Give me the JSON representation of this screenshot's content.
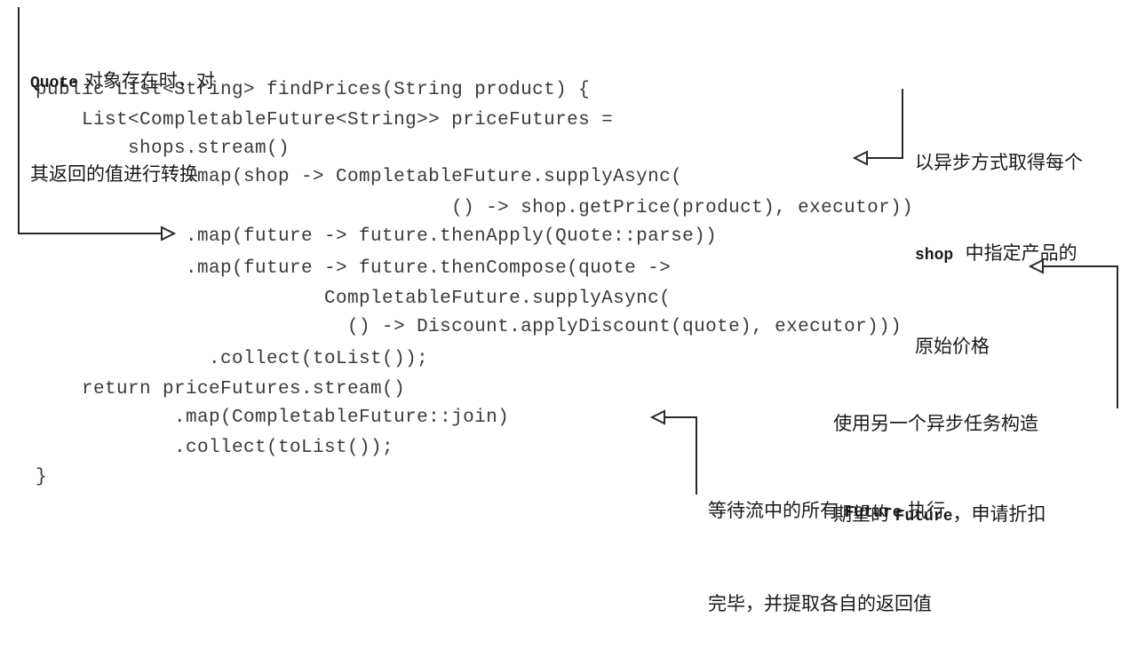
{
  "code": {
    "lines": [
      "public List<String> findPrices(String product) {",
      "    List<CompletableFuture<String>> priceFutures =",
      "        shops.stream()",
      "             .map(shop -> CompletableFuture.supplyAsync(",
      "                                    () -> shop.getPrice(product), executor))",
      "             .map(future -> future.thenApply(Quote::parse))",
      "             .map(future -> future.thenCompose(quote ->",
      "                         CompletableFuture.supplyAsync(",
      "                           () -> Discount.applyDiscount(quote), executor)))",
      "               .collect(toList());",
      "    return priceFutures.stream()",
      "            .map(CompletableFuture::join)",
      "            .collect(toList());",
      "}"
    ]
  },
  "annotations": [
    {
      "id": "transform-quote",
      "line1_mono": "Quote",
      "line1_text": " 对象存在时，对",
      "line2_text": "其返回的值进行转换"
    },
    {
      "id": "async-price",
      "line1_text": "以异步方式取得每个",
      "line2_mono": "shop",
      "line2_text": "  中指定产品的",
      "line3_text": "原始价格"
    },
    {
      "id": "compose-discount",
      "line1_text": "使用另一个异步任务构造",
      "line2_pre": "期望的 ",
      "line2_mono": "Future",
      "line2_text": "，申请折扣"
    },
    {
      "id": "join-results",
      "line1_pre": "等待流中的所有 ",
      "line1_mono": "Future",
      "line1_text": " 执行",
      "line2_text": "完毕，并提取各自的返回值"
    }
  ]
}
